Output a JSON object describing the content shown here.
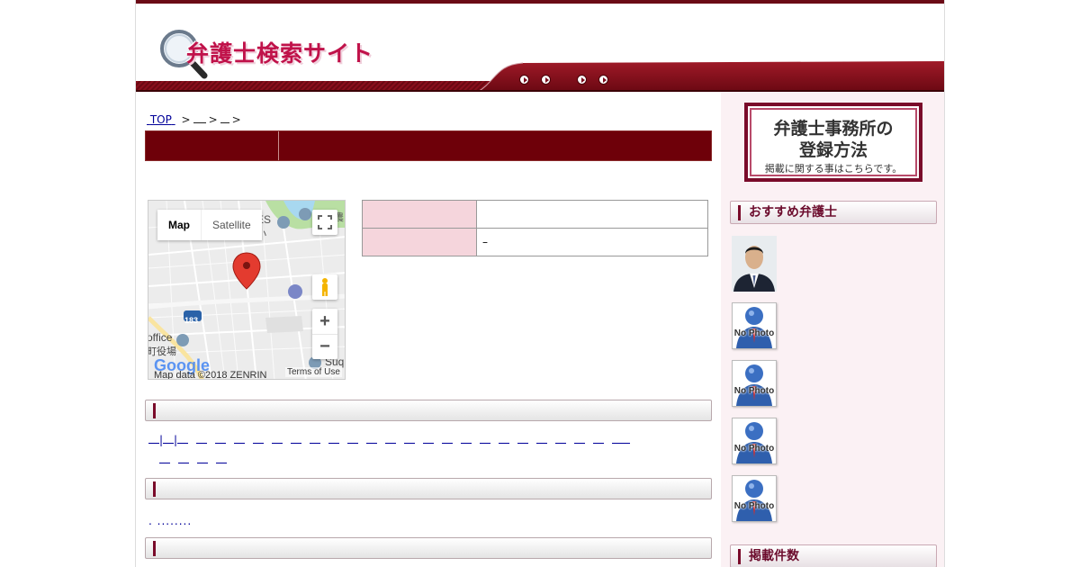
{
  "header": {
    "logo_text": "弁護士検索サイト"
  },
  "breadcrumb": {
    "top_label": "TOP",
    "sep": ">"
  },
  "map": {
    "type_map": "Map",
    "type_satellite": "Satellite",
    "zoom_in": "+",
    "zoom_out": "−",
    "copyright": "Map data ©2018 ZENRIN",
    "terms": "Terms of Use",
    "labels": {
      "es": "ES",
      "small": "小",
      "office": "office",
      "yakuba": "町役場",
      "route": "183",
      "bun": "文",
      "suq": "Suq",
      "nou": "農"
    }
  },
  "info_table": {
    "rows": [
      {
        "key": "",
        "value": ""
      },
      {
        "key": "",
        "value": "–"
      }
    ]
  },
  "dots": ". ........",
  "sidebar": {
    "banner": {
      "line1": "弁護士事務所の",
      "line2": "登録方法",
      "line3": "掲載に関する事はこちらです。"
    },
    "recommended_heading": "おすすめ弁護士",
    "nophoto_label": "No Photo",
    "count_heading": "掲載件数"
  },
  "colors": {
    "brand": "#6e0009",
    "accent": "#c0124a",
    "table_key_bg": "#f5d5dc"
  }
}
